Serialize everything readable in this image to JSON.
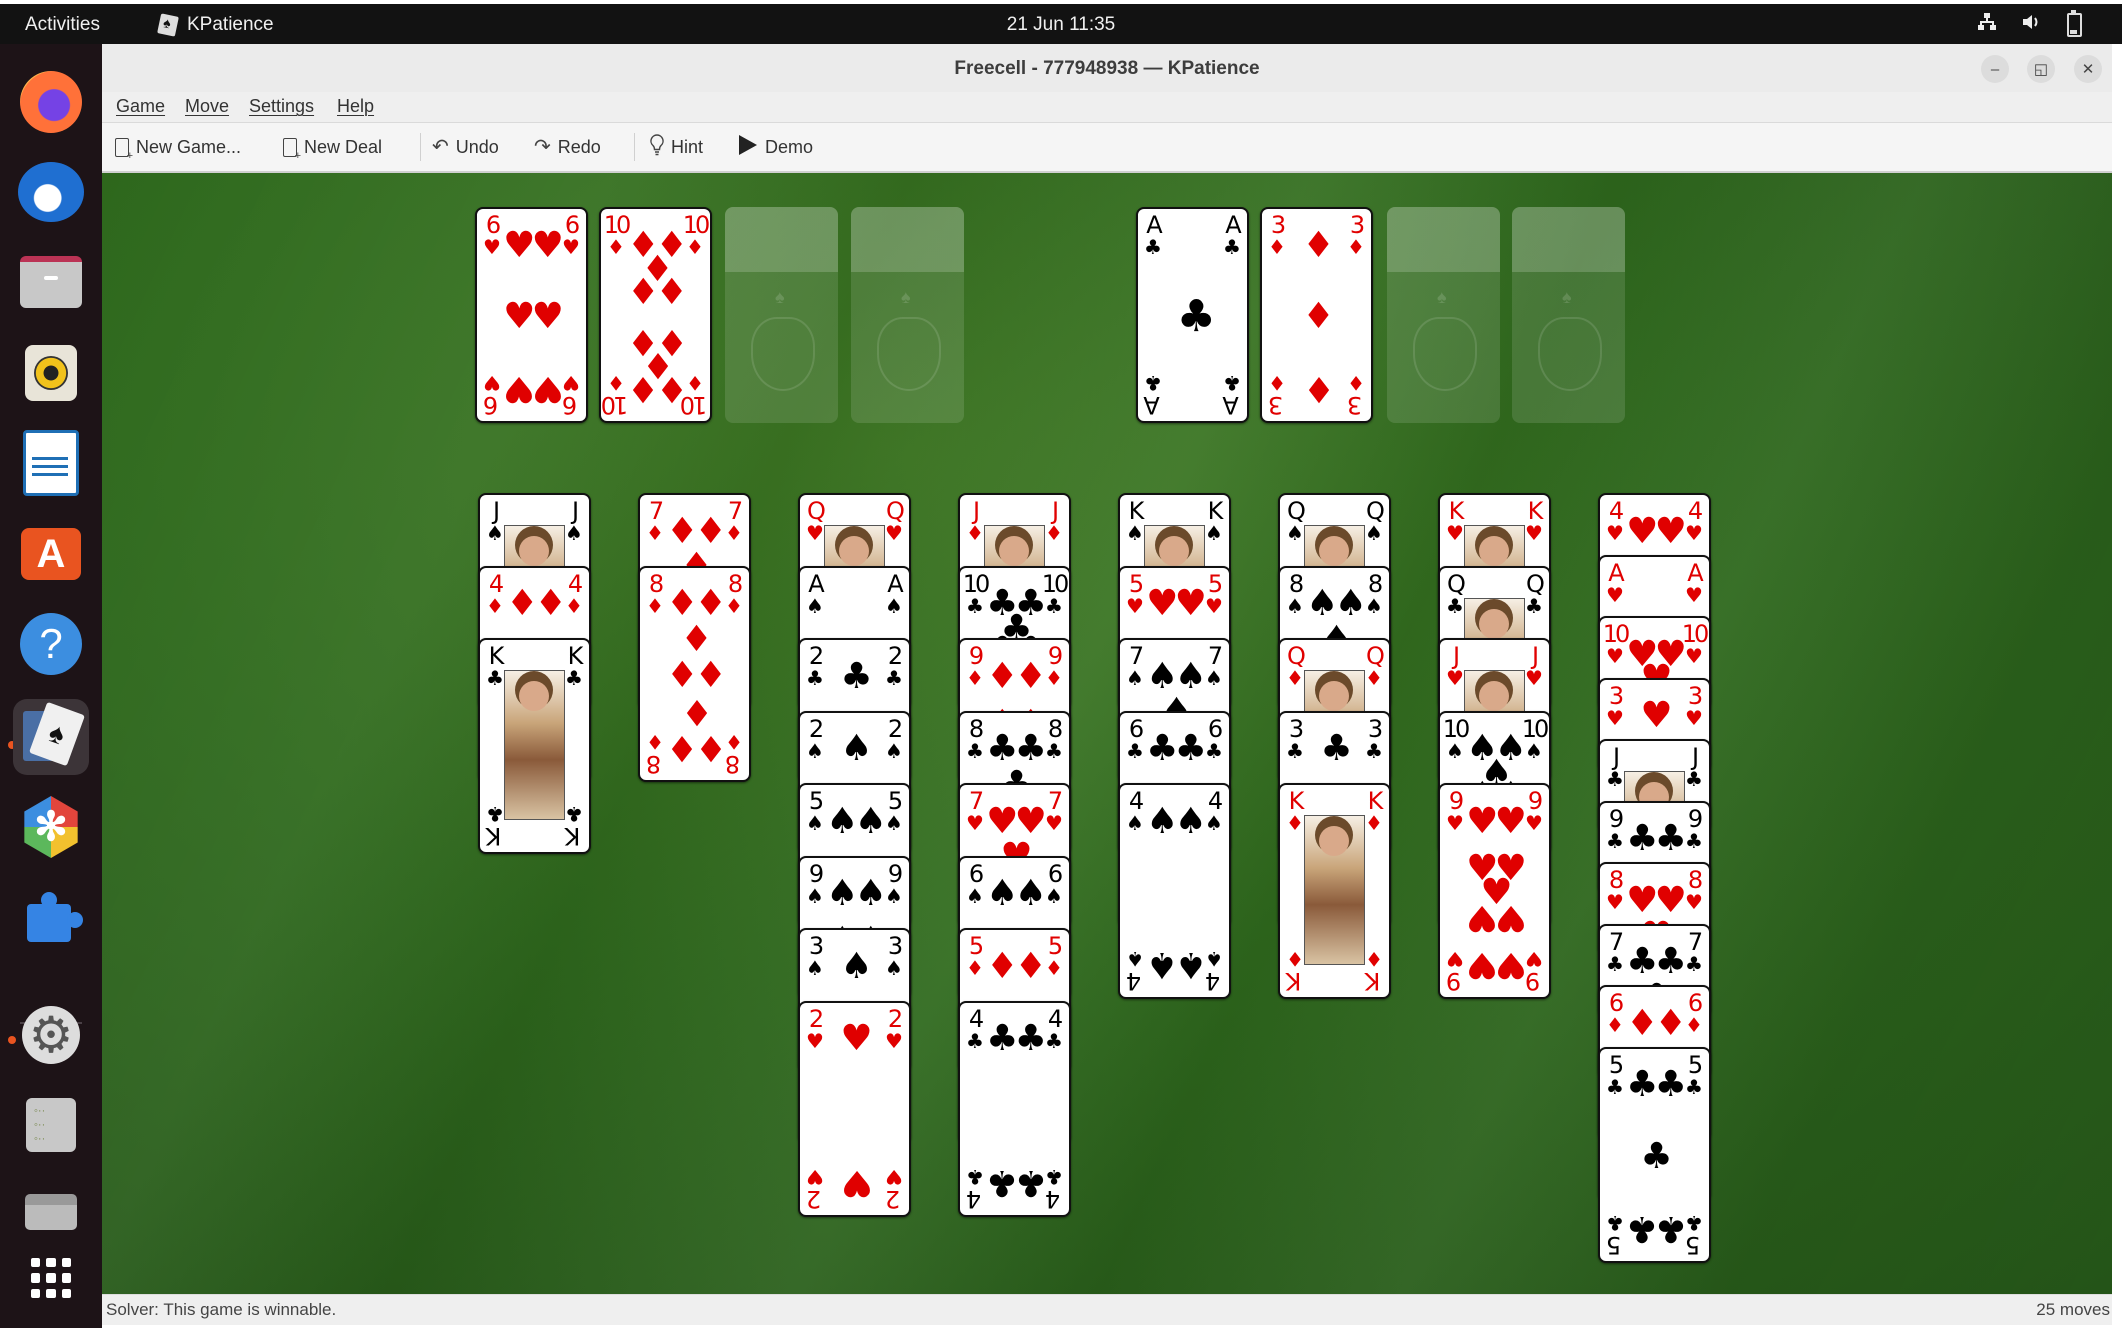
{
  "topbar": {
    "activities": "Activities",
    "app_name": "KPatience",
    "clock": "21 Jun  11:35",
    "tray_icons": [
      "network-icon",
      "volume-icon",
      "battery-icon"
    ]
  },
  "dock": {
    "items": [
      {
        "name": "firefox",
        "icon": "firefox-icon",
        "running": false,
        "active": false
      },
      {
        "name": "thunderbird",
        "icon": "thunderbird-icon",
        "running": false,
        "active": false
      },
      {
        "name": "files",
        "icon": "files-icon",
        "running": false,
        "active": false
      },
      {
        "name": "rhythmbox",
        "icon": "rhythmbox-icon",
        "running": false,
        "active": false
      },
      {
        "name": "libreoffice-writer",
        "icon": "writer-icon",
        "running": false,
        "active": false
      },
      {
        "name": "app-center",
        "icon": "app-center-icon",
        "running": false,
        "active": false
      },
      {
        "name": "help",
        "icon": "help-icon",
        "running": false,
        "active": false
      },
      {
        "name": "kpatience",
        "icon": "kpatience-icon",
        "running": true,
        "active": true
      },
      {
        "name": "preferences",
        "icon": "preferences-icon",
        "running": false,
        "active": false
      },
      {
        "name": "extensions",
        "icon": "puzzle-icon",
        "running": false,
        "active": false
      },
      {
        "name": "settings",
        "icon": "settings-icon",
        "running": true,
        "active": false
      },
      {
        "name": "list-app",
        "icon": "list-icon",
        "running": false,
        "active": false
      },
      {
        "name": "drive",
        "icon": "drive-icon",
        "running": false,
        "active": false
      },
      {
        "name": "show-apps",
        "icon": "app-grid-icon",
        "running": false,
        "active": false
      }
    ]
  },
  "window": {
    "title": "Freecell - 777948938 — KPatience",
    "controls": {
      "minimize": "–",
      "restore": "◱",
      "close": "✕"
    }
  },
  "menubar": [
    "Game",
    "Move",
    "Settings",
    "Help"
  ],
  "toolbar": {
    "new_game": "New Game...",
    "new_deal": "New Deal",
    "undo": "Undo",
    "redo": "Redo",
    "hint": "Hint",
    "demo": "Demo"
  },
  "game": {
    "variant": "Freecell",
    "deal_number": "777948938",
    "freecells": [
      {
        "rank": "6",
        "suit": "hearts"
      },
      {
        "rank": "10",
        "suit": "diamonds"
      },
      null,
      null
    ],
    "foundations": [
      {
        "rank": "A",
        "suit": "clubs"
      },
      {
        "rank": "3",
        "suit": "diamonds"
      },
      null,
      null
    ],
    "tableau": [
      [
        {
          "rank": "J",
          "suit": "spades"
        },
        {
          "rank": "4",
          "suit": "diamonds"
        },
        {
          "rank": "K",
          "suit": "clubs"
        }
      ],
      [
        {
          "rank": "7",
          "suit": "diamonds"
        },
        {
          "rank": "8",
          "suit": "diamonds"
        }
      ],
      [
        {
          "rank": "Q",
          "suit": "hearts"
        },
        {
          "rank": "A",
          "suit": "spades"
        },
        {
          "rank": "2",
          "suit": "clubs"
        },
        {
          "rank": "2",
          "suit": "spades"
        },
        {
          "rank": "5",
          "suit": "spades"
        },
        {
          "rank": "9",
          "suit": "spades"
        },
        {
          "rank": "3",
          "suit": "spades"
        },
        {
          "rank": "2",
          "suit": "hearts"
        }
      ],
      [
        {
          "rank": "J",
          "suit": "diamonds"
        },
        {
          "rank": "10",
          "suit": "clubs"
        },
        {
          "rank": "9",
          "suit": "diamonds"
        },
        {
          "rank": "8",
          "suit": "clubs"
        },
        {
          "rank": "7",
          "suit": "hearts"
        },
        {
          "rank": "6",
          "suit": "spades"
        },
        {
          "rank": "5",
          "suit": "diamonds"
        },
        {
          "rank": "4",
          "suit": "clubs"
        }
      ],
      [
        {
          "rank": "K",
          "suit": "spades"
        },
        {
          "rank": "5",
          "suit": "hearts"
        },
        {
          "rank": "7",
          "suit": "spades"
        },
        {
          "rank": "6",
          "suit": "clubs"
        },
        {
          "rank": "4",
          "suit": "spades"
        }
      ],
      [
        {
          "rank": "Q",
          "suit": "spades"
        },
        {
          "rank": "8",
          "suit": "spades"
        },
        {
          "rank": "Q",
          "suit": "diamonds"
        },
        {
          "rank": "3",
          "suit": "clubs"
        },
        {
          "rank": "K",
          "suit": "diamonds"
        }
      ],
      [
        {
          "rank": "K",
          "suit": "hearts"
        },
        {
          "rank": "Q",
          "suit": "clubs"
        },
        {
          "rank": "J",
          "suit": "hearts"
        },
        {
          "rank": "10",
          "suit": "spades"
        },
        {
          "rank": "9",
          "suit": "hearts"
        }
      ],
      [
        {
          "rank": "4",
          "suit": "hearts"
        },
        {
          "rank": "A",
          "suit": "hearts"
        },
        {
          "rank": "10",
          "suit": "hearts"
        },
        {
          "rank": "3",
          "suit": "hearts"
        },
        {
          "rank": "J",
          "suit": "clubs"
        },
        {
          "rank": "9",
          "suit": "clubs"
        },
        {
          "rank": "8",
          "suit": "hearts"
        },
        {
          "rank": "7",
          "suit": "clubs"
        },
        {
          "rank": "6",
          "suit": "diamonds"
        },
        {
          "rank": "5",
          "suit": "clubs"
        }
      ]
    ]
  },
  "statusbar": {
    "message": "Solver: This game is winnable.",
    "moves": "25 moves"
  },
  "colors": {
    "felt_dark": "#245418",
    "felt_light": "#3f7a24",
    "red_suit": "#e00000",
    "black_suit": "#000000",
    "accent": "#e95420"
  }
}
